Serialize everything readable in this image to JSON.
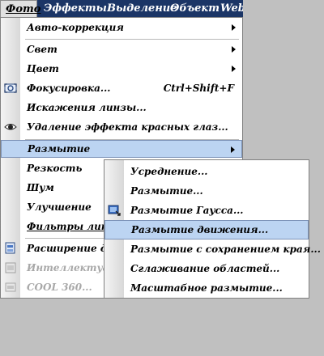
{
  "menubar": {
    "items": [
      {
        "label": "Фото"
      },
      {
        "label": "Эффекты"
      },
      {
        "label": "Выделение"
      },
      {
        "label": "Объект"
      },
      {
        "label": "Web"
      }
    ]
  },
  "photo_menu": {
    "items": [
      {
        "label": "Авто-коррекция"
      },
      {
        "label": "Свет"
      },
      {
        "label": "Цвет"
      },
      {
        "label": "Фокусировка...",
        "shortcut": "Ctrl+Shift+F"
      },
      {
        "label": "Искажения линзы..."
      },
      {
        "label": "Удаление эффекта красных глаз..."
      },
      {
        "label": "Размытие"
      },
      {
        "label": "Резкость"
      },
      {
        "label": "Шум"
      },
      {
        "label": "Улучшение"
      },
      {
        "label": "Фильтры линз"
      },
      {
        "label": "Расширение дин"
      },
      {
        "label": "Интеллектуаль"
      },
      {
        "label": "COOL 360..."
      }
    ]
  },
  "blur_submenu": {
    "items": [
      {
        "label": "Усреднение..."
      },
      {
        "label": "Размытие..."
      },
      {
        "label": "Размытие Гаусса..."
      },
      {
        "label": "Размытие движения..."
      },
      {
        "label": "Размытие с сохранением края..."
      },
      {
        "label": "Сглаживание областей..."
      },
      {
        "label": "Масштабное размытие..."
      }
    ]
  },
  "colors": {
    "menubar_bg": "#1b3566",
    "highlight_bg": "#bcd4f2"
  }
}
